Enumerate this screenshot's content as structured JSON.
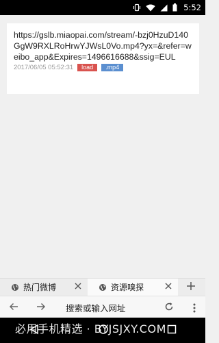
{
  "status_bar": {
    "time": "5:52",
    "icons": [
      "vibrate-icon",
      "wifi-icon",
      "signal-icon",
      "battery-icon"
    ]
  },
  "item": {
    "url": "https://gslb.miaopai.com/stream/-bzj0HzuD140GgW9RXLRoHrwYJWsL0Vo.mp4?yx=&refer=weibo_app&Expires=1496616688&ssig=EUL",
    "timestamp": "2017/06/05 05:52:31",
    "load_label": "load",
    "ext_label": ".mp4"
  },
  "tabs": [
    {
      "label": "热门微博",
      "icon": "globe-icon",
      "active": false
    },
    {
      "label": "资源嗅探",
      "icon": "globe-icon",
      "active": true
    }
  ],
  "toolbar": {
    "address_placeholder": "搜索或输入网址"
  },
  "watermark": {
    "text": "必用手机精选 · BYJSJXY.COM"
  },
  "colors": {
    "load_badge": "#d9534f",
    "ext_badge": "#5b8fd0",
    "background": "#f0f0f0"
  }
}
